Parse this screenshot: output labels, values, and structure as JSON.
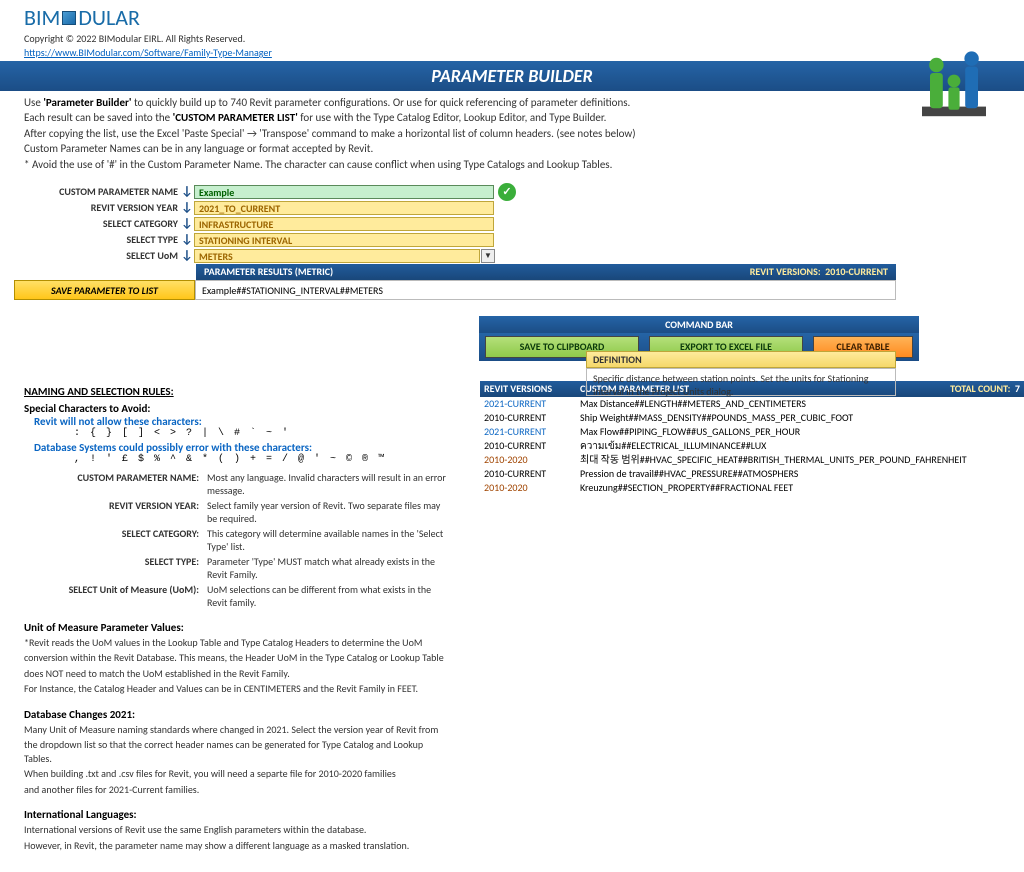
{
  "brand": {
    "name": "BIM",
    "suffix": "DULAR",
    "copyright": "Copyright © 2022 BIModular EIRL.  All Rights Reserved.",
    "link": "https://www.BIModular.com/Software/Family-Type-Manager"
  },
  "title": "PARAMETER BUILDER",
  "intro": {
    "l1a": "Use ",
    "l1b": "'Parameter Builder'",
    "l1c": " to quickly build up to 740 Revit parameter configurations.   Or use for quick referencing of parameter definitions.",
    "l2a": "Each result can be saved into the ",
    "l2b": "'CUSTOM PARAMETER LIST'",
    "l2c": " for use with the Type Catalog Editor, Lookup Editor, and Type Builder.",
    "l3": "After copying the list, use the Excel 'Paste Special' → 'Transpose' command to make a horizontal list of column headers.   (see notes below)",
    "l4": "Custom Parameter Names can be in any language or format accepted by Revit.",
    "l5": "* Avoid the use of '#' in the Custom Parameter Name.  The character can cause conflict when using Type Catalogs and Lookup Tables."
  },
  "form": {
    "labels": {
      "name": "CUSTOM PARAMETER NAME",
      "year": "REVIT VERSION YEAR",
      "cat": "SELECT CATEGORY",
      "type": "SELECT TYPE",
      "uom": "SELECT UoM"
    },
    "values": {
      "name": "Example",
      "year": "2021_TO_CURRENT",
      "cat": "INFRASTRUCTURE",
      "type": "STATIONING INTERVAL",
      "uom": "METERS"
    }
  },
  "definition": {
    "header": "DEFINITION",
    "body": "Specific distance between station points. Set the units for Stationing Interval in the Project Units dialog."
  },
  "results": {
    "label": "PARAMETER RESULTS   (METRIC)",
    "revlabel": "REVIT VERSIONS:",
    "revval": "2010-CURRENT",
    "savebtn": "SAVE PARAMETER TO LIST",
    "value": "Example##STATIONING_INTERVAL##METERS"
  },
  "cmdbar": {
    "title": "COMMAND BAR",
    "b1": "SAVE TO CLIPBOARD",
    "b2": "EXPORT TO EXCEL FILE",
    "b3": "CLEAR TABLE"
  },
  "list": {
    "h1": "REVIT VERSIONS",
    "h2": "CUSTOM PARAMETER LIST",
    "h3": "TOTAL COUNT:",
    "count": "7",
    "rows": [
      {
        "ver": "2021-CURRENT",
        "cls": "ver-new",
        "text": "Max Distance##LENGTH##METERS_AND_CENTIMETERS"
      },
      {
        "ver": "2010-CURRENT",
        "cls": "",
        "text": "Ship Weight##MASS_DENSITY##POUNDS_MASS_PER_CUBIC_FOOT"
      },
      {
        "ver": "2021-CURRENT",
        "cls": "ver-new",
        "text": "Max Flow##PIPING_FLOW##US_GALLONS_PER_HOUR"
      },
      {
        "ver": "2010-CURRENT",
        "cls": "",
        "text": "ความเข้ม##ELECTRICAL_ILLUMINANCE##LUX"
      },
      {
        "ver": "2010-2020",
        "cls": "ver-old",
        "text": "최대 작동 범위##HVAC_SPECIFIC_HEAT##BRITISH_THERMAL_UNITS_PER_POUND_FAHRENHEIT"
      },
      {
        "ver": "2010-CURRENT",
        "cls": "",
        "text": "Pression de travail##HVAC_PRESSURE##ATMOSPHERS"
      },
      {
        "ver": "2010-2020",
        "cls": "ver-old",
        "text": "Kreuzung##SECTION_PROPERTY##FRACTIONAL FEET"
      }
    ]
  },
  "rules": {
    "header": "NAMING AND SELECTION RULES:",
    "special": {
      "h": "Special Characters to Avoid:",
      "revit": "Revit will not allow these characters:",
      "revitchars": ":  { }  [ ]  <  >  ?  |  \\  #  `  ~  '",
      "db": "Database Systems could possibly error with these characters:",
      "dbchars": ",  !  '  £  $  %  ^  &  *  (  )  +  =  /  @  '  ~  ©  ®  ™"
    },
    "grid": {
      "r1": {
        "l": "CUSTOM PARAMETER NAME:",
        "r": "Most any language.  Invalid characters will result in an error message."
      },
      "r2": {
        "l": "REVIT VERSION YEAR:",
        "r": "Select family year version of Revit.  Two separate files may be required."
      },
      "r3": {
        "l": "SELECT CATEGORY:",
        "r": "This category will determine available names in the 'Select Type' list."
      },
      "r4": {
        "l": "SELECT TYPE:",
        "r": "Parameter 'Type' MUST match what already exists in the Revit Family."
      },
      "r5": {
        "l": "SELECT Unit of Measure (UoM):",
        "r": "UoM selections can be different from what exists in the Revit family."
      }
    },
    "uom": {
      "h": "Unit of Measure Parameter Values:",
      "p1": "*Revit reads the UoM values in the Lookup Table and Type Catalog Headers to determine the UoM",
      "p2": "conversion within the Revit Database.   This means, the Header UoM in the Type Catalog or Lookup Table",
      "p3": "does NOT need to match the UoM established in the Revit Family.",
      "p4": "For Instance, the Catalog Header and Values can be in CENTIMETERS and the Revit Family in FEET."
    },
    "db": {
      "h": "Database Changes 2021:",
      "p1": "Many Unit of Measure naming standards where changed in 2021.  Select the version year of Revit from",
      "p2": "the dropdown list so that the correct header names can be generated for Type Catalog and Lookup Tables.",
      "p3": "When building .txt and .csv files for Revit, you will need a separte file for 2010-2020 families",
      "p4": "and another files for 2021-Current families."
    },
    "intl": {
      "h": "International Languages:",
      "p1": "International versions of Revit use the same English parameters within the database.",
      "p2": "However, in Revit, the parameter name may show a different language as a masked translation."
    }
  }
}
